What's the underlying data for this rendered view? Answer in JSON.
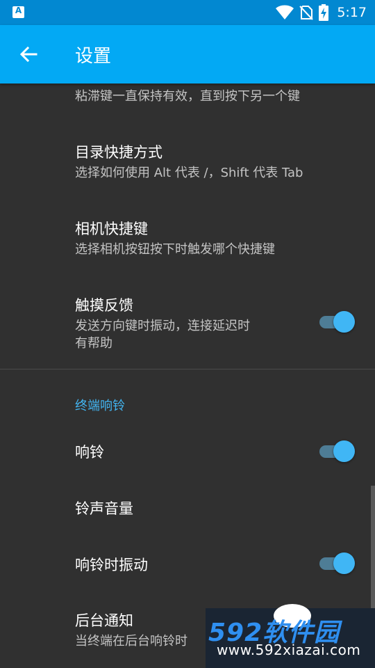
{
  "status_bar": {
    "app_icon_letter": "A",
    "time": "5:17",
    "icons": [
      "wifi-icon",
      "no-sim-icon",
      "battery-charging-icon"
    ]
  },
  "app_bar": {
    "back_icon": "arrow-back-icon",
    "title": "设置"
  },
  "preferences": {
    "sticky_keys": {
      "summary": "粘滞键一直保持有效，直到按下另一个键"
    },
    "dir_shortcut": {
      "title": "目录快捷方式",
      "summary": "选择如何使用 Alt 代表 /，Shift 代表 Tab"
    },
    "camera_shortcut": {
      "title": "相机快捷键",
      "summary": "选择相机按钮按下时触发哪个快捷键"
    },
    "haptic_feedback": {
      "title": "触摸反馈",
      "summary_line1": "发送方向键时振动，连接延迟时",
      "summary_line2": "有帮助",
      "enabled": true
    }
  },
  "bell_section": {
    "category": "终端响铃",
    "items": {
      "bell": {
        "title": "响铃",
        "enabled": true
      },
      "bell_volume": {
        "title": "铃声音量"
      },
      "bell_vibrate": {
        "title": "响铃时振动",
        "enabled": true
      },
      "bg_notify": {
        "title": "后台通知",
        "summary": "当终端在后台响铃时"
      }
    }
  },
  "watermark": {
    "logo": "592软件园",
    "url": "www.592xiazai.com"
  },
  "colors": {
    "status_bar": "#0288d1",
    "app_bar": "#03a9f4",
    "background": "#303030",
    "accent": "#42b4f0",
    "switch_thumb": "#40b6f5",
    "switch_track": "#4e7d96"
  }
}
